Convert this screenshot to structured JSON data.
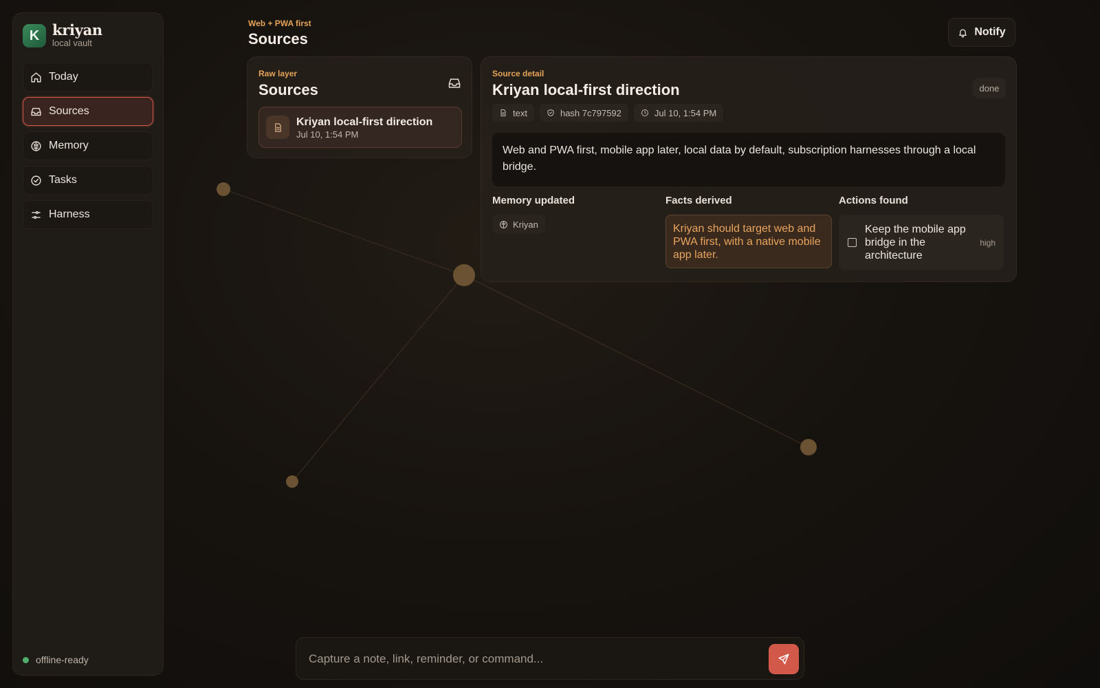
{
  "brand": {
    "logo_letter": "K",
    "name": "kriyan",
    "subtitle": "local vault"
  },
  "sidebar": {
    "items": [
      {
        "label": "Today",
        "icon": "home-icon",
        "active": false
      },
      {
        "label": "Sources",
        "icon": "inbox-icon",
        "active": true
      },
      {
        "label": "Memory",
        "icon": "brain-icon",
        "active": false
      },
      {
        "label": "Tasks",
        "icon": "check-circle-icon",
        "active": false
      },
      {
        "label": "Harness",
        "icon": "sliders-icon",
        "active": false
      }
    ],
    "status": "offline-ready"
  },
  "header": {
    "eyebrow": "Web + PWA first",
    "title": "Sources",
    "notify_label": "Notify"
  },
  "raw_layer": {
    "eyebrow": "Raw layer",
    "title": "Sources",
    "items": [
      {
        "title": "Kriyan local-first direction",
        "date": "Jul 10, 1:54 PM"
      }
    ]
  },
  "detail": {
    "eyebrow": "Source detail",
    "title": "Kriyan local-first direction",
    "status": "done",
    "meta": {
      "type": "text",
      "hash": "hash 7c797592",
      "date": "Jul 10, 1:54 PM"
    },
    "body": "Web and PWA first, mobile app later, local data by default, subscription harnesses through a local bridge.",
    "memory_title": "Memory updated",
    "memory_chip": "Kriyan",
    "facts_title": "Facts derived",
    "fact": "Kriyan should target web and PWA first, with a native mobile app later.",
    "actions_title": "Actions found",
    "action": {
      "text": "Keep the mobile app bridge in the architecture",
      "priority": "high"
    }
  },
  "capture": {
    "placeholder": "Capture a note, link, reminder, or command..."
  },
  "colors": {
    "accent": "#d2584a",
    "eyebrow": "#e4a45a",
    "status_ok": "#4fae6a",
    "graph_node": "#6b5233"
  }
}
